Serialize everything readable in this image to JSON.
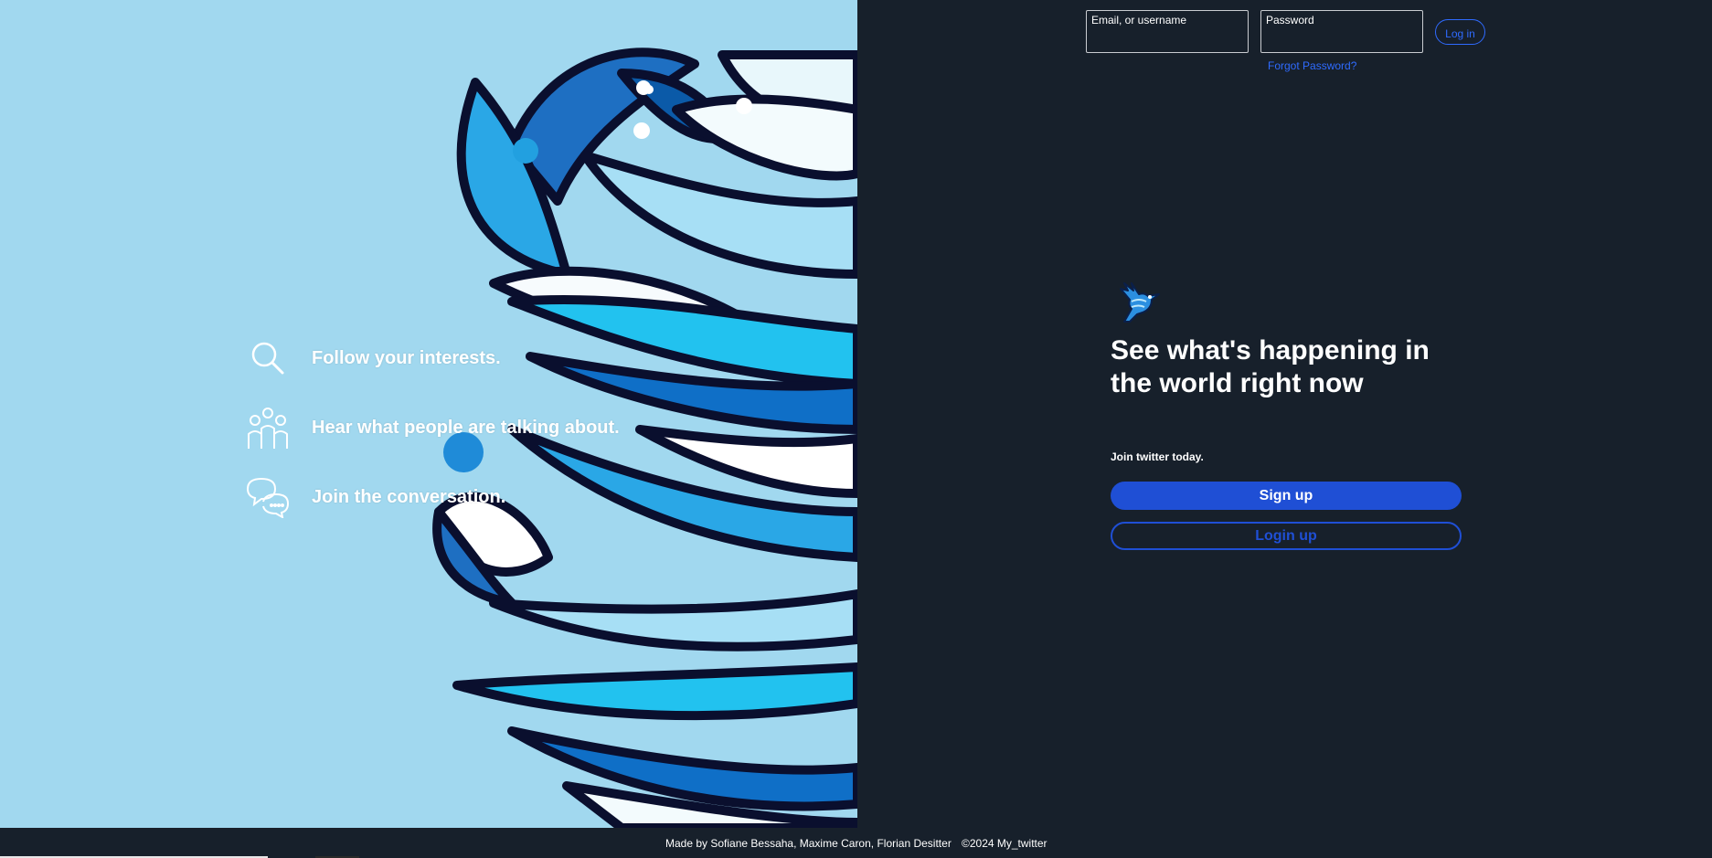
{
  "left": {
    "features": [
      {
        "icon": "search-icon",
        "text": "Follow your interests."
      },
      {
        "icon": "people-icon",
        "text": "Hear what people are talking about."
      },
      {
        "icon": "chat-bubbles-icon",
        "text": "Join the conversation."
      }
    ]
  },
  "login": {
    "username_label": "Email, or username",
    "password_label": "Password",
    "login_button": "Log in",
    "forgot_link": "Forgot Password?"
  },
  "main": {
    "logo_icon": "bird-logo-icon",
    "headline": "See what's happening in the world right now",
    "join_text": "Join twitter today.",
    "signup_button": "Sign up",
    "login_up_button": "Login up"
  },
  "footer": {
    "credits": "Made by Sofiane Bessaha, Maxime Caron, Florian Desitter",
    "copyright": "©2024 My_twitter"
  },
  "colors": {
    "left_background": "#a1d8ef",
    "right_background": "#17202b",
    "accent": "#1f4fd5",
    "link": "#2f6bff"
  }
}
